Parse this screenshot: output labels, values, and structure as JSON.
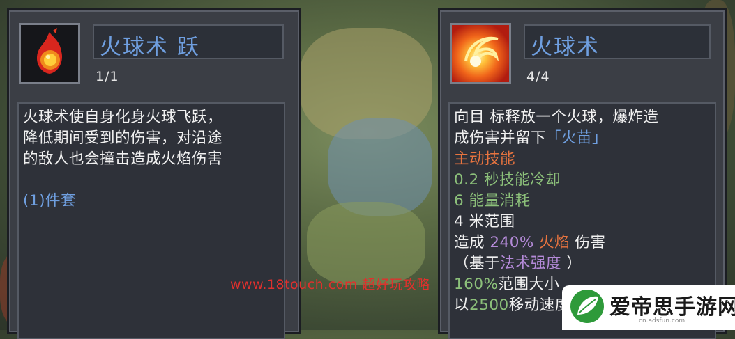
{
  "left_skill": {
    "icon": "fireball-drop-icon",
    "title": "火球术 跃",
    "level": "1/1",
    "description": [
      [
        {
          "t": "火球术使自身化身火球飞跃，",
          "c": "white"
        }
      ],
      [
        {
          "t": "降低期间受到的伤害，对沿途",
          "c": "white"
        }
      ],
      [
        {
          "t": "的敌人也会撞击造成火焰伤害",
          "c": "white"
        }
      ],
      [
        {
          "t": "",
          "c": "white"
        }
      ],
      [
        {
          "t": "(1)件套",
          "c": "blue"
        }
      ]
    ]
  },
  "right_skill": {
    "icon": "fireball-swirl-icon",
    "title": "火球术",
    "level": "4/4",
    "description": [
      [
        {
          "t": "向目 标释放一个火球，爆炸造",
          "c": "white"
        }
      ],
      [
        {
          "t": "成伤害并留下",
          "c": "white"
        },
        {
          "t": "「火苗」",
          "c": "blue"
        }
      ],
      [
        {
          "t": "主动技能",
          "c": "orange"
        }
      ],
      [
        {
          "t": "0.2 秒技能冷却",
          "c": "green"
        }
      ],
      [
        {
          "t": "6 能量消耗",
          "c": "green"
        }
      ],
      [
        {
          "t": "4 米范围",
          "c": "white"
        }
      ],
      [
        {
          "t": "造成 ",
          "c": "white"
        },
        {
          "t": "240%",
          "c": "purple"
        },
        {
          "t": " 火焰",
          "c": "orange"
        },
        {
          "t": " 伤害",
          "c": "white"
        }
      ],
      [
        {
          "t": "（基于",
          "c": "white"
        },
        {
          "t": "法术强度",
          "c": "purple"
        },
        {
          "t": " ）",
          "c": "white"
        }
      ],
      [
        {
          "t": "160%",
          "c": "green"
        },
        {
          "t": "范围大小",
          "c": "white"
        }
      ],
      [
        {
          "t": "以",
          "c": "white"
        },
        {
          "t": "2500",
          "c": "green"
        },
        {
          "t": "移动速度该劫",
          "c": "white"
        }
      ]
    ]
  },
  "watermark": "www.18touch.com 超好玩攻略",
  "logo": {
    "name": "爱帝思手游网",
    "url": "cn.adsfun.com"
  },
  "colors": {
    "white": "#f1f1f1",
    "blue": "#6f9fe0",
    "orange": "#e8743f",
    "green": "#8cc07a",
    "purple": "#b48ad8"
  }
}
